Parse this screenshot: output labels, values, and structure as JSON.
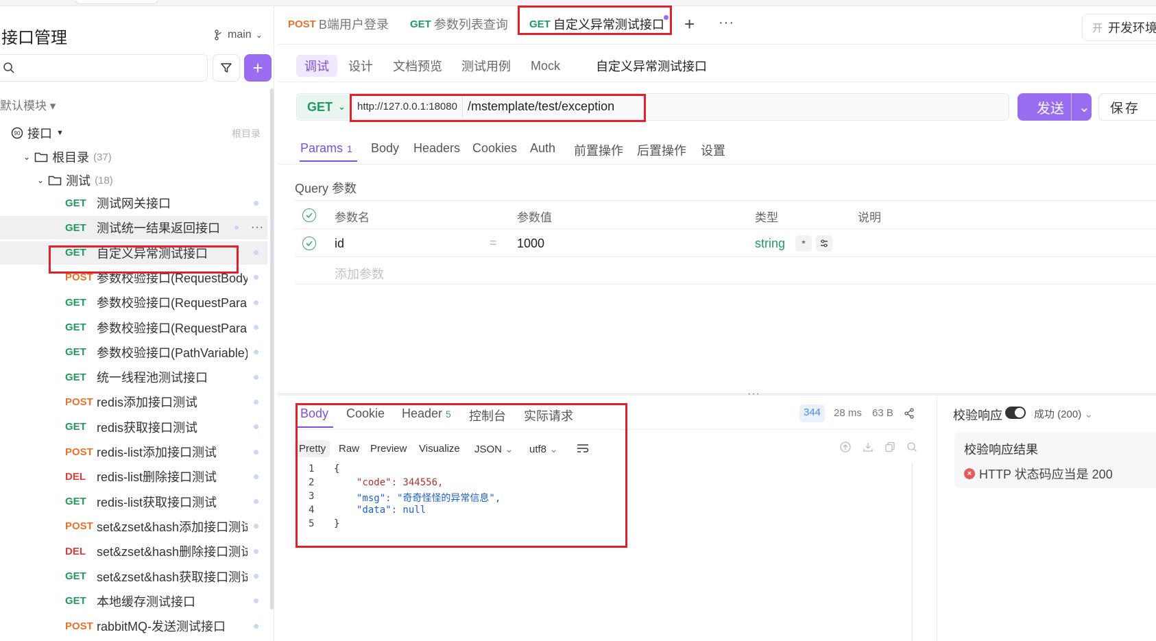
{
  "sidebar": {
    "title": "接口管理",
    "branch": "main",
    "default_module": "默认模块 ▾",
    "api_group": "接口",
    "root_tag": "根目录",
    "root_folder": "根目录",
    "root_count": "(37)",
    "test_folder": "测试",
    "test_count": "(18)",
    "items": [
      {
        "method": "GET",
        "name": "测试网关接口"
      },
      {
        "method": "GET",
        "name": "测试统一结果返回接口"
      },
      {
        "method": "GET",
        "name": "自定义异常测试接口"
      },
      {
        "method": "POST",
        "name": "参数校验接口(RequestBody)"
      },
      {
        "method": "GET",
        "name": "参数校验接口(RequestPara..."
      },
      {
        "method": "GET",
        "name": "参数校验接口(RequestPara..."
      },
      {
        "method": "GET",
        "name": "参数校验接口(PathVariable)"
      },
      {
        "method": "GET",
        "name": "统一线程池测试接口"
      },
      {
        "method": "POST",
        "name": "redis添加接口测试"
      },
      {
        "method": "GET",
        "name": "redis获取接口测试"
      },
      {
        "method": "POST",
        "name": "redis-list添加接口测试"
      },
      {
        "method": "DEL",
        "name": "redis-list删除接口测试"
      },
      {
        "method": "GET",
        "name": "redis-list获取接口测试"
      },
      {
        "method": "POST",
        "name": "set&zset&hash添加接口测试"
      },
      {
        "method": "DEL",
        "name": "set&zset&hash删除接口测试"
      },
      {
        "method": "GET",
        "name": "set&zset&hash获取接口测试"
      },
      {
        "method": "GET",
        "name": "本地缓存测试接口"
      },
      {
        "method": "POST",
        "name": "rabbitMQ-发送测试接口"
      }
    ]
  },
  "tabs": [
    {
      "method": "POST",
      "title": "B端用户登录"
    },
    {
      "method": "GET",
      "title": "参数列表查询"
    },
    {
      "method": "GET",
      "title": "自定义异常测试接口"
    }
  ],
  "environment": {
    "key": "开",
    "label": "开发环境"
  },
  "subtabs": [
    "调试",
    "设计",
    "文档预览",
    "测试用例",
    "Mock"
  ],
  "request": {
    "name": "自定义异常测试接口",
    "method": "GET",
    "base_url": "http://127.0.0.1:18080",
    "path": "/mstemplate/test/exception",
    "send_label": "发送",
    "save_label": "保存"
  },
  "param_tabs": [
    {
      "label": "Params",
      "badge": "1"
    },
    {
      "label": "Body"
    },
    {
      "label": "Headers"
    },
    {
      "label": "Cookies"
    },
    {
      "label": "Auth"
    },
    {
      "label": "前置操作"
    },
    {
      "label": "后置操作"
    },
    {
      "label": "设置"
    }
  ],
  "query": {
    "title": "Query 参数",
    "headers": [
      "参数名",
      "参数值",
      "类型",
      "说明"
    ],
    "rows": [
      {
        "name": "id",
        "eq": "=",
        "value": "1000",
        "type": "string",
        "required": "*"
      }
    ],
    "add_placeholder": "添加参数"
  },
  "response": {
    "tabs": [
      {
        "label": "Body"
      },
      {
        "label": "Cookie"
      },
      {
        "label": "Header",
        "badge": "5"
      },
      {
        "label": "控制台"
      },
      {
        "label": "实际请求"
      }
    ],
    "status": "344",
    "time": "28 ms",
    "size": "63 B",
    "formats": [
      "Pretty",
      "Raw",
      "Preview",
      "Visualize"
    ],
    "lang": "JSON",
    "encoding": "utf8",
    "body_lines": [
      "{",
      "\"code\": 344556,",
      "\"msg\": \"奇奇怪怪的异常信息\",",
      "\"data\": null",
      "}"
    ]
  },
  "validation": {
    "title": "校验响应",
    "status_label": "成功 (200)",
    "result_title": "校验响应结果",
    "fail_message": "HTTP 状态码应当是 200"
  },
  "colors": {
    "accent": "#9a6cf0",
    "get": "#1f9b5d",
    "post": "#e8712a",
    "del": "#e03a3a",
    "highlight": "#e0202a"
  }
}
